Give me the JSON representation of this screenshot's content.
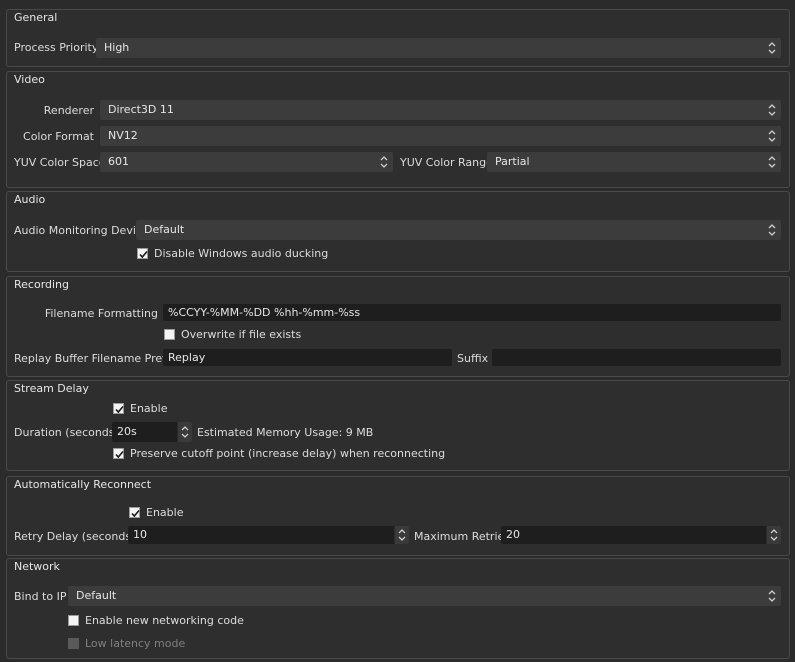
{
  "general": {
    "title": "General",
    "process_priority_label": "Process Priority",
    "process_priority_value": "High"
  },
  "video": {
    "title": "Video",
    "renderer_label": "Renderer",
    "renderer_value": "Direct3D 11",
    "color_format_label": "Color Format",
    "color_format_value": "NV12",
    "yuv_color_space_label": "YUV Color Space",
    "yuv_color_space_value": "601",
    "yuv_color_range_label": "YUV Color Range",
    "yuv_color_range_value": "Partial"
  },
  "audio": {
    "title": "Audio",
    "monitoring_device_label": "Audio Monitoring Device",
    "monitoring_device_value": "Default",
    "disable_ducking_label": "Disable Windows audio ducking",
    "disable_ducking_checked": true
  },
  "recording": {
    "title": "Recording",
    "filename_formatting_label": "Filename Formatting",
    "filename_formatting_value": "%CCYY-%MM-%DD %hh-%mm-%ss",
    "overwrite_label": "Overwrite if file exists",
    "overwrite_checked": false,
    "replay_prefix_label": "Replay Buffer Filename Prefix",
    "replay_prefix_value": "Replay",
    "suffix_label": "Suffix",
    "suffix_value": ""
  },
  "stream_delay": {
    "title": "Stream Delay",
    "enable_label": "Enable",
    "enable_checked": true,
    "duration_label": "Duration (seconds)",
    "duration_value": "20s",
    "memory_usage": "Estimated Memory Usage: 9 MB",
    "preserve_label": "Preserve cutoff point (increase delay) when reconnecting",
    "preserve_checked": true
  },
  "reconnect": {
    "title": "Automatically Reconnect",
    "enable_label": "Enable",
    "enable_checked": true,
    "retry_delay_label": "Retry Delay (seconds)",
    "retry_delay_value": "10",
    "max_retries_label": "Maximum Retries",
    "max_retries_value": "20"
  },
  "network": {
    "title": "Network",
    "bind_ip_label": "Bind to IP",
    "bind_ip_value": "Default",
    "new_networking_label": "Enable new networking code",
    "new_networking_checked": false,
    "low_latency_label": "Low latency mode",
    "low_latency_checked": false
  },
  "icons": {
    "combo_arrows": "up-down-chevron-icon",
    "spin_arrows": "spinbox-arrows-icon",
    "check": "checkmark-icon"
  }
}
